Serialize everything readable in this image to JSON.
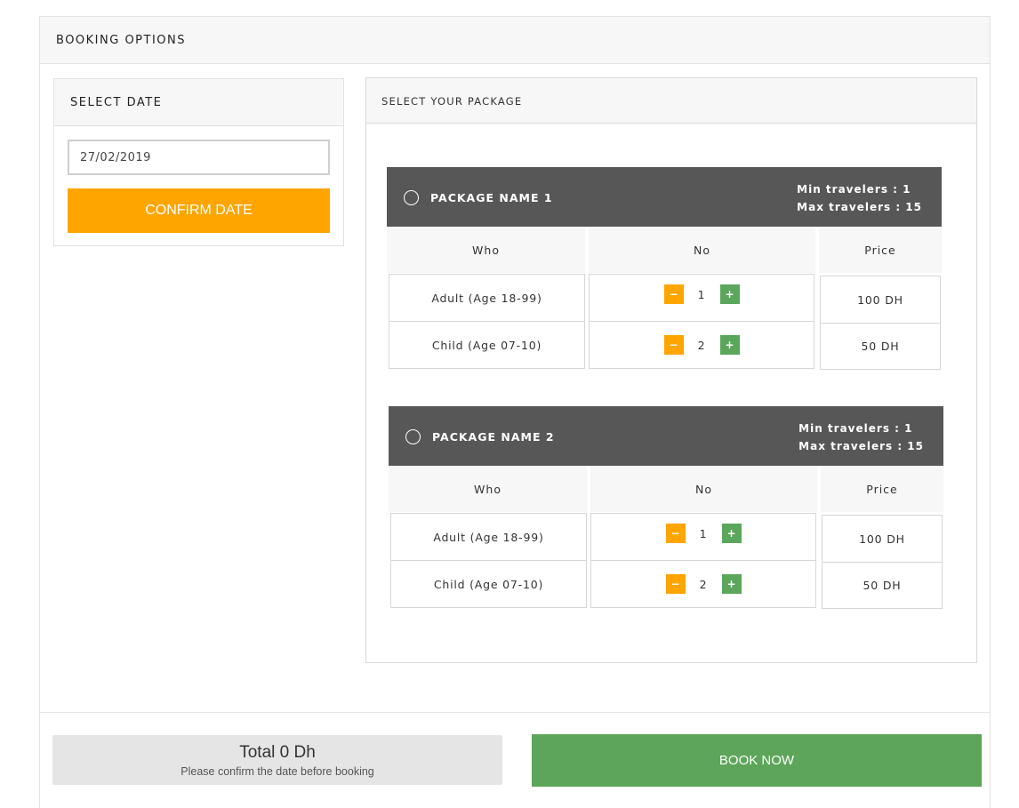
{
  "booking": {
    "title": "BOOKING OPTIONS"
  },
  "date_panel": {
    "title": "SELECT DATE",
    "date_value": "27/02/2019",
    "confirm_label": "CONFIRM DATE"
  },
  "package_panel": {
    "title": "SELECT YOUR PACKAGE",
    "columns": [
      "Who",
      "No",
      "Price"
    ],
    "packages": [
      {
        "name": "PACKAGE NAME 1",
        "min_travelers": "Min travelers : 1",
        "max_travelers": "Max travelers : 15",
        "rows": [
          {
            "who": "Adult (Age 18-99)",
            "no": "1",
            "price": "100 DH"
          },
          {
            "who": "Child (Age 07-10)",
            "no": "2",
            "price": "50 DH"
          }
        ]
      },
      {
        "name": "PACKAGE NAME 2",
        "min_travelers": "Min travelers : 1",
        "max_travelers": "Max travelers : 15",
        "rows": [
          {
            "who": "Adult (Age 18-99)",
            "no": "1",
            "price": "100 DH"
          },
          {
            "who": "Child (Age 07-10)",
            "no": "2",
            "price": "50 DH"
          }
        ]
      }
    ],
    "minus_symbol": "−",
    "plus_symbol": "+"
  },
  "footer": {
    "total_label": "Total 0 Dh",
    "total_note": "Please confirm the date before booking",
    "book_label": "BOOK NOW"
  },
  "colors": {
    "accent_orange": "#ffa500",
    "accent_green": "#5ca55a",
    "package_header": "#575757"
  }
}
